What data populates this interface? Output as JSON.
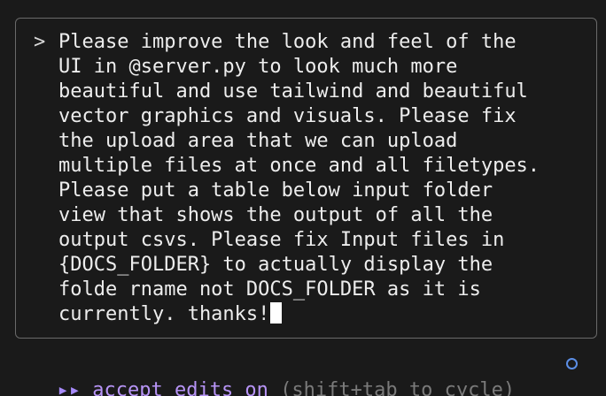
{
  "prompt": {
    "caret": ">",
    "lines": [
      "Please improve the look and feel of the",
      "UI in @server.py to look much more",
      "beautiful and use tailwind and beautiful",
      "vector graphics and visuals. Please fix",
      "the upload area that we can upload",
      "multiple files at once and all filetypes.",
      "Please put a table below input folder",
      "view that shows the output of all the",
      "output csvs. Please fix Input files in",
      "{DOCS_FOLDER} to actually display the",
      "folde rname not DOCS_FOLDER as it is",
      "currently. thanks!"
    ]
  },
  "status": {
    "icon": "fast-forward-icon",
    "icon_glyph": "▸▸",
    "mode_label": "accept edits on",
    "hint": "(shift+tab to cycle)",
    "indicator": "circle-icon"
  },
  "colors": {
    "background": "#1a1a1a",
    "border": "#6a6a6a",
    "text": "#ededed",
    "accent": "#b794f6",
    "hint": "#7a7a7a",
    "indicator": "#5b8ee6"
  }
}
